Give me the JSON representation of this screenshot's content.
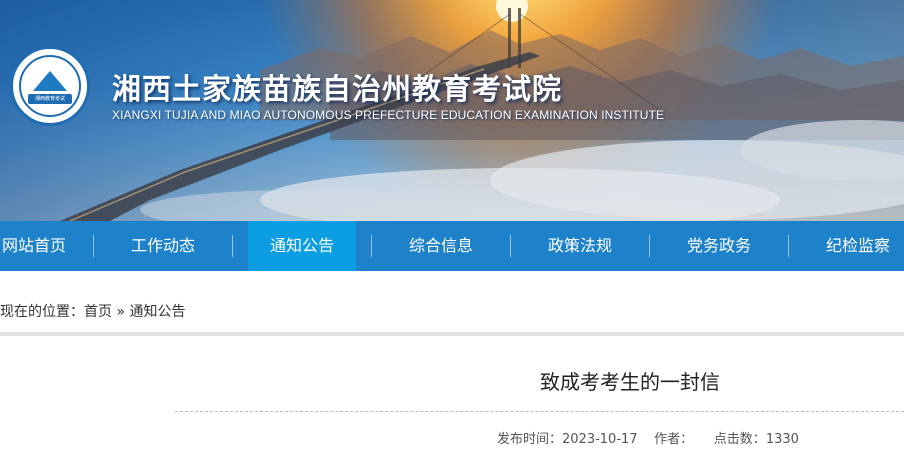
{
  "header": {
    "title": "湘西土家族苗族自治州教育考试院",
    "subtitle": "XIANGXI TUJIA AND MIAO AUTONOMOUS PREFECTURE EDUCATION EXAMINATION INSTITUTE",
    "logo_text": "湘西教育考试",
    "logo_icon": "mountain-book-emblem"
  },
  "nav": {
    "items": [
      {
        "label": "网站首页",
        "active": false
      },
      {
        "label": "工作动态",
        "active": false
      },
      {
        "label": "通知公告",
        "active": true
      },
      {
        "label": "综合信息",
        "active": false
      },
      {
        "label": "政策法规",
        "active": false
      },
      {
        "label": "党务政务",
        "active": false
      },
      {
        "label": "纪检监察",
        "active": false
      }
    ]
  },
  "breadcrumb": {
    "prefix": "您现在的位置：",
    "home": "首页",
    "separator": " » ",
    "current": "通知公告"
  },
  "article": {
    "title": "致成考考生的一封信",
    "publish_label": "发布时间：",
    "publish_date": "2023-10-17",
    "author_label": "作者：",
    "author": "",
    "views_label": "点击数：",
    "views": "1330"
  },
  "colors": {
    "nav_bg": "#1d82c9",
    "nav_active": "#0b9ee2",
    "title_text": "#ffffff"
  }
}
